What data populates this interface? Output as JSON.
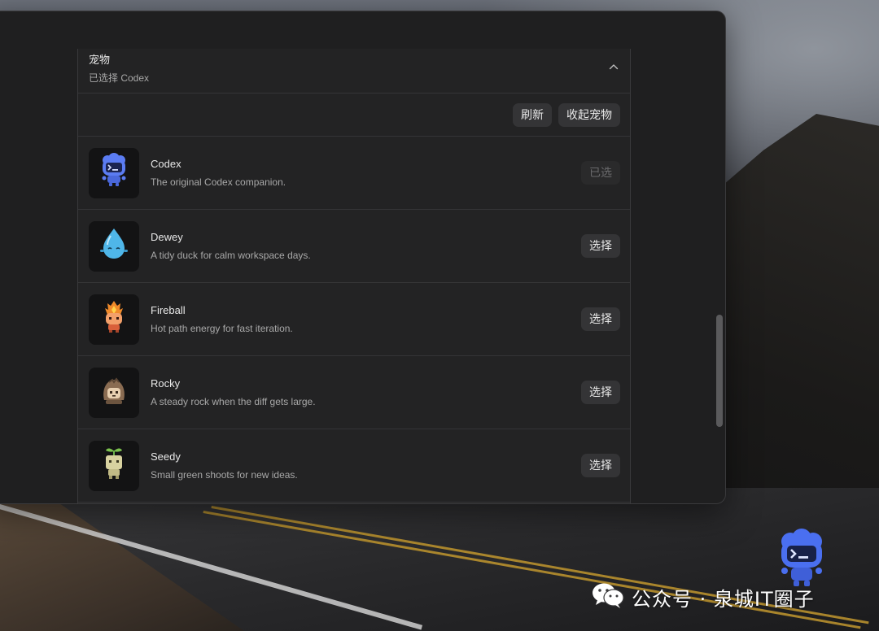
{
  "panel": {
    "title": "宠物",
    "subtitle": "已选择 Codex",
    "collapse_icon": "chevron-up-icon"
  },
  "toolbar": {
    "refresh_label": "刷新",
    "hide_pets_label": "收起宠物"
  },
  "pets": [
    {
      "name": "Codex",
      "description": "The original Codex companion.",
      "action": "已选",
      "selected": true,
      "icon": "codex-robot-icon",
      "color": "#5b7cf2"
    },
    {
      "name": "Dewey",
      "description": "A tidy duck for calm workspace days.",
      "action": "选择",
      "selected": false,
      "icon": "dewey-droplet-icon",
      "color": "#4fb6e8"
    },
    {
      "name": "Fireball",
      "description": "Hot path energy for fast iteration.",
      "action": "选择",
      "selected": false,
      "icon": "fireball-icon",
      "color": "#e8743a"
    },
    {
      "name": "Rocky",
      "description": "A steady rock when the diff gets large.",
      "action": "选择",
      "selected": false,
      "icon": "rocky-icon",
      "color": "#a88a70"
    },
    {
      "name": "Seedy",
      "description": "Small green shoots for new ideas.",
      "action": "选择",
      "selected": false,
      "icon": "seedy-sprout-icon",
      "color": "#d8d2a0"
    }
  ],
  "desktop_mascot": {
    "icon": "codex-robot-icon",
    "color": "#4a6ff0"
  },
  "watermark": {
    "text": "公众号 · 泉城IT圈子",
    "icon": "wechat-icon"
  }
}
